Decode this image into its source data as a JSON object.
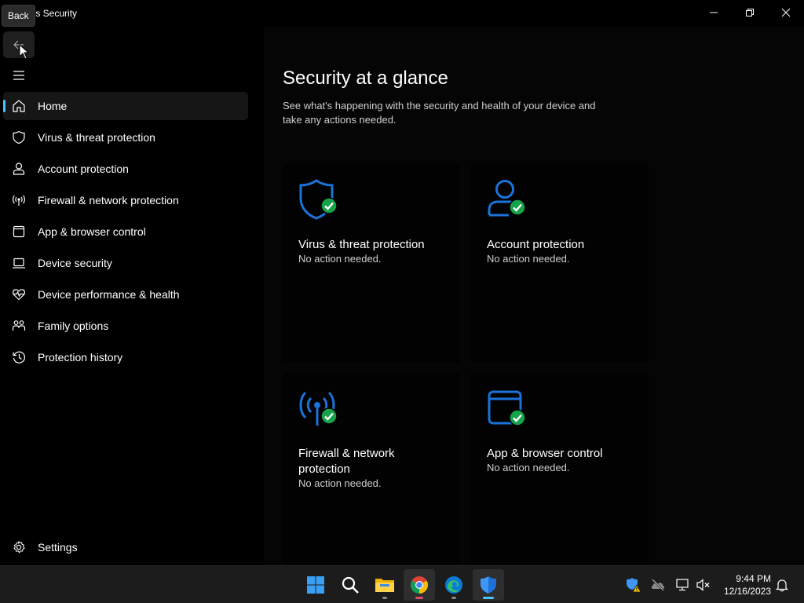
{
  "window": {
    "title": "ows Security",
    "tooltip": "Back"
  },
  "sidebar": {
    "items": [
      {
        "label": "Home",
        "icon": "home-icon",
        "selected": true
      },
      {
        "label": "Virus & threat protection",
        "icon": "shield-icon"
      },
      {
        "label": "Account protection",
        "icon": "person-icon"
      },
      {
        "label": "Firewall & network protection",
        "icon": "antenna-icon"
      },
      {
        "label": "App & browser control",
        "icon": "app-window-icon"
      },
      {
        "label": "Device security",
        "icon": "laptop-icon"
      },
      {
        "label": "Device performance & health",
        "icon": "heart-pulse-icon"
      },
      {
        "label": "Family options",
        "icon": "family-icon"
      },
      {
        "label": "Protection history",
        "icon": "history-icon"
      }
    ],
    "settings_label": "Settings"
  },
  "main": {
    "title": "Security at a glance",
    "description": "See what's happening with the security and health of your device and take any actions needed.",
    "cards": [
      {
        "title": "Virus & threat protection",
        "status": "No action needed.",
        "icon": "shield-check-icon"
      },
      {
        "title": "Account protection",
        "status": "No action needed.",
        "icon": "account-check-icon"
      },
      {
        "title": "Firewall & network protection",
        "status": "No action needed.",
        "icon": "antenna-check-icon"
      },
      {
        "title": "App & browser control",
        "status": "No action needed.",
        "icon": "browser-check-icon"
      }
    ]
  },
  "taskbar": {
    "time": "9:44 PM",
    "date": "12/16/2023",
    "apps": [
      "start-icon",
      "search-icon",
      "file-explorer-icon",
      "chrome-icon",
      "edge-icon",
      "windows-security-icon"
    ]
  },
  "colors": {
    "accent": "#4cc2ff",
    "icon_blue": "#1a73d9",
    "check_green": "#16a34a",
    "background": "#000000"
  }
}
